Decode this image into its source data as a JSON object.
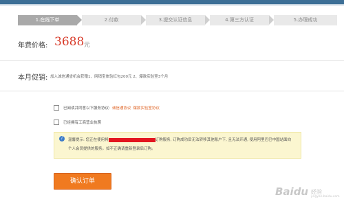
{
  "steps": [
    {
      "label": "1.在线下单",
      "active": true
    },
    {
      "label": "2.付款",
      "active": false
    },
    {
      "label": "3.提交认证信息",
      "active": false
    },
    {
      "label": "4.第三方认证",
      "active": false
    },
    {
      "label": "5.办理成功",
      "active": false
    }
  ],
  "price": {
    "label": "年费价格:",
    "value": "3688",
    "unit": "元"
  },
  "promo": {
    "label": "本月促销:",
    "text": "加入诚信通省机会获赠1、网销宝体验红包200元 2、爆款实验室3个月"
  },
  "agreement": {
    "text": "已阅读并同意以下服务协议:",
    "link1": "诚信通协议",
    "link2": "爆款实验室协议"
  },
  "business_license": {
    "text": "已经拥有工商营业执照"
  },
  "notice": {
    "icon": "i",
    "line1_prefix": "温馨提示: 您正在使用将",
    "line1_suffix": "订购服务, 订购成功后无法转移其他账户下, 且无法开通, 使用阿里巴巴中国站面向",
    "line2": "个人会员提供的服务。如不正确请重新登录后订购。"
  },
  "confirm_button": {
    "label": "确认订单"
  },
  "watermark": {
    "logo": "Baidu",
    "sub": "经验",
    "url": "jingyan.baidu.com"
  }
}
